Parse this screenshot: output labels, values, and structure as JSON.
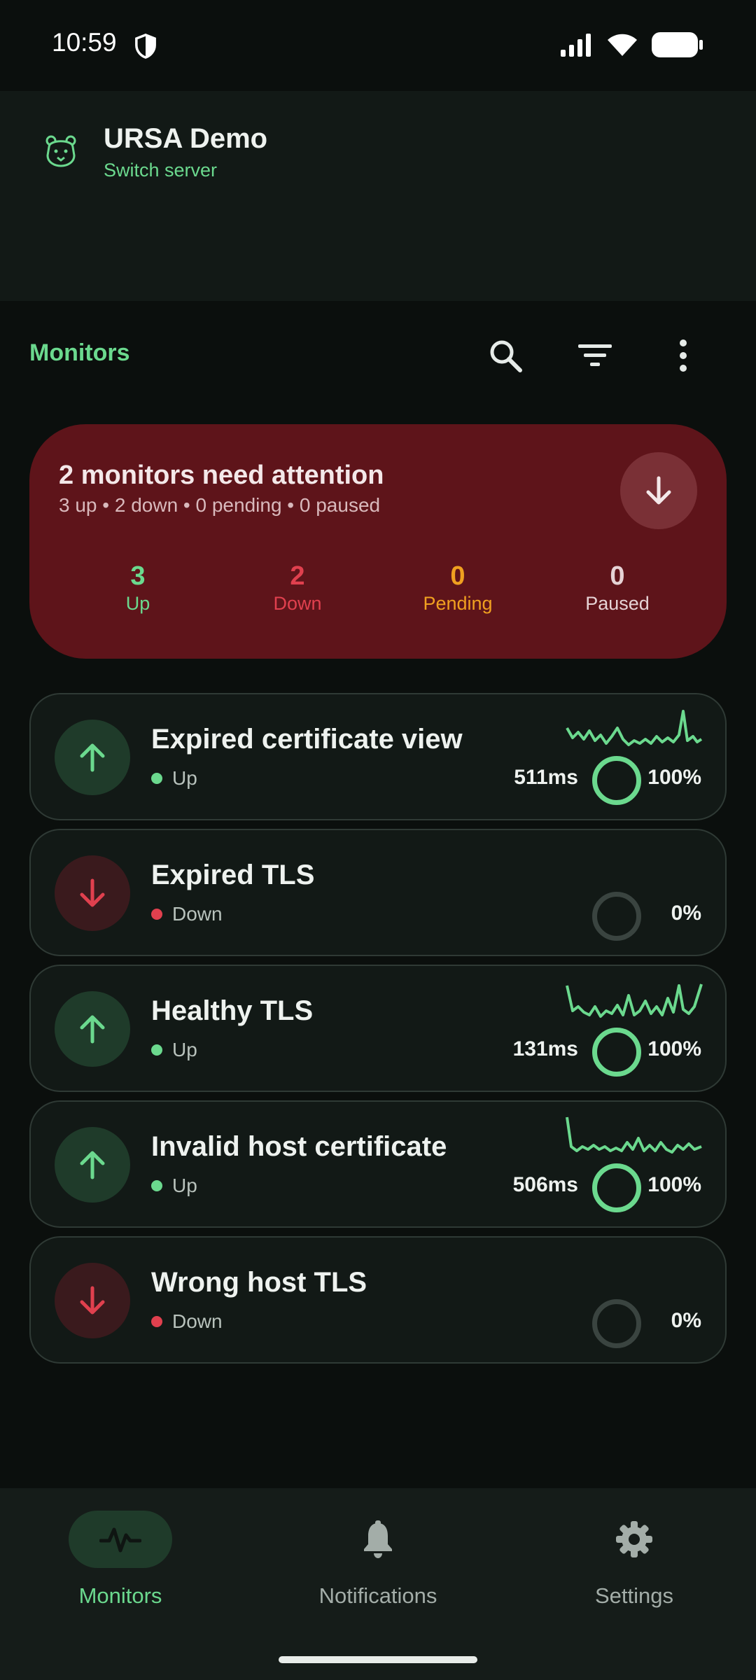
{
  "status_bar": {
    "time": "10:59"
  },
  "server": {
    "name": "URSA Demo",
    "switch_label": "Switch server"
  },
  "toolbar": {
    "title": "Monitors"
  },
  "attention": {
    "title": "2 monitors need attention",
    "subtitle": "3 up • 2 down • 0 pending • 0 paused",
    "stats": [
      {
        "value": "3",
        "label": "Up",
        "color": "#6bd98e"
      },
      {
        "value": "2",
        "label": "Down",
        "color": "#e0404e"
      },
      {
        "value": "0",
        "label": "Pending",
        "color": "#f0a020"
      },
      {
        "value": "0",
        "label": "Paused",
        "color": "#e6d3d5"
      }
    ]
  },
  "monitors": [
    {
      "name": "Expired certificate view",
      "status": "Up",
      "response": "511ms",
      "uptime": "100%"
    },
    {
      "name": "Expired TLS",
      "status": "Down",
      "response": "",
      "uptime": "0%"
    },
    {
      "name": "Healthy TLS",
      "status": "Up",
      "response": "131ms",
      "uptime": "100%"
    },
    {
      "name": "Invalid host certificate",
      "status": "Up",
      "response": "506ms",
      "uptime": "100%"
    },
    {
      "name": "Wrong host TLS",
      "status": "Down",
      "response": "",
      "uptime": "0%"
    }
  ],
  "nav": {
    "items": [
      {
        "label": "Monitors",
        "icon": "pulse-icon",
        "active": true
      },
      {
        "label": "Notifications",
        "icon": "bell-icon",
        "active": false
      },
      {
        "label": "Settings",
        "icon": "gear-icon",
        "active": false
      }
    ]
  },
  "colors": {
    "accent": "#6bd98e",
    "down": "#e0404e",
    "pending": "#f0a020",
    "attention_bg": "#5e141a"
  }
}
